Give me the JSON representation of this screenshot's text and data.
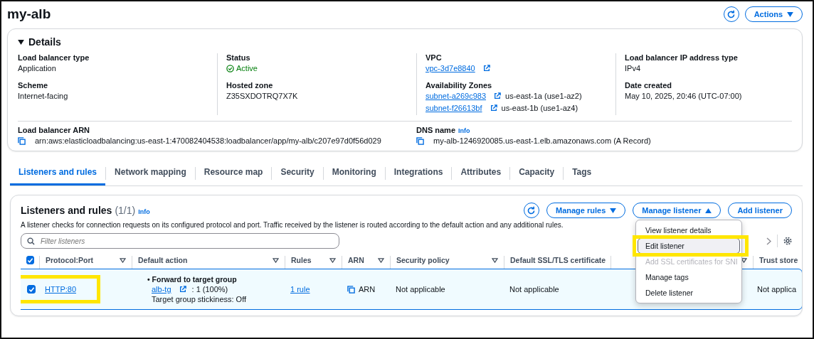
{
  "page": {
    "title": "my-alb",
    "actions_button": "Actions"
  },
  "details": {
    "title": "Details",
    "expanded": true,
    "columns": [
      [
        {
          "label": "Load balancer type",
          "kind": "text",
          "value": "Application"
        },
        {
          "label": "Scheme",
          "kind": "text",
          "value": "Internet-facing"
        }
      ],
      [
        {
          "label": "Status",
          "kind": "status",
          "value": "Active"
        },
        {
          "label": "Hosted zone",
          "kind": "text",
          "value": "Z35SXDOTRQ7X7K"
        }
      ],
      [
        {
          "label": "VPC",
          "kind": "link",
          "value": "vpc-3d7e8840"
        },
        {
          "label": "Availability Zones",
          "kind": "zones",
          "zones": [
            {
              "subnet": "subnet-a269c983",
              "zone": "us-east-1a (use1-az2)"
            },
            {
              "subnet": "subnet-f26613bf",
              "zone": "us-east-1b (use1-az4)"
            }
          ]
        }
      ],
      [
        {
          "label": "Load balancer IP address type",
          "kind": "text",
          "value": "IPv4"
        },
        {
          "label": "Date created",
          "kind": "text",
          "value": "May 10, 2025, 20:46 (UTC-07:00)"
        }
      ]
    ],
    "bottom": [
      {
        "label": "Load balancer ARN",
        "kind": "copy",
        "value": "arn:aws:elasticloadbalancing:us-east-1:470082404538:loadbalancer/app/my-alb/c207e97d0f56d029"
      },
      {
        "label": "DNS name",
        "info": "Info",
        "kind": "copy",
        "value": "my-alb-1246920085.us-east-1.elb.amazonaws.com (A Record)"
      }
    ]
  },
  "tabs": [
    {
      "label": "Listeners and rules",
      "selected": true
    },
    {
      "label": "Network mapping",
      "selected": false
    },
    {
      "label": "Resource map",
      "selected": false
    },
    {
      "label": "Security",
      "selected": false
    },
    {
      "label": "Monitoring",
      "selected": false
    },
    {
      "label": "Integrations",
      "selected": false
    },
    {
      "label": "Attributes",
      "selected": false
    },
    {
      "label": "Capacity",
      "selected": false
    },
    {
      "label": "Tags",
      "selected": false
    }
  ],
  "listeners": {
    "title": "Listeners and rules",
    "count": "(1/1)",
    "info": "Info",
    "description": "A listener checks for connection requests on its configured protocol and port. Traffic received by the listener is routed according to the default action and any additional rules.",
    "buttons": [
      {
        "label": "Manage rules",
        "kind": "dropdown",
        "expanded": false
      },
      {
        "label": "Manage listener",
        "kind": "dropdown",
        "expanded": true
      },
      {
        "label": "Add listener",
        "kind": "plain"
      }
    ],
    "menu": [
      {
        "label": "View listener details",
        "disabled": false,
        "hovered": false,
        "highlighted": false
      },
      {
        "label": "Edit listener",
        "disabled": false,
        "hovered": true,
        "highlighted": true
      },
      {
        "label": "Add SSL certificates for SNI",
        "disabled": true,
        "hovered": false,
        "highlighted": false
      },
      {
        "label": "Manage tags",
        "disabled": false,
        "hovered": false,
        "highlighted": false
      },
      {
        "label": "Delete listener",
        "disabled": false,
        "hovered": false,
        "highlighted": false
      }
    ],
    "filter": {
      "placeholder": "Filter listeners"
    },
    "all_checked": true,
    "columns": [
      {
        "label": "Protocol:Port"
      },
      {
        "label": "Default action"
      },
      {
        "label": "Rules"
      },
      {
        "label": "ARN"
      },
      {
        "label": "Security policy"
      },
      {
        "label": "Default SSL/TLS certificate"
      },
      {
        "sortable": true
      },
      {
        "label": "Trust store"
      }
    ],
    "rows": [
      {
        "selected": true,
        "highlighted": true,
        "protocol_port": "HTTP:80",
        "action_bullet": "•",
        "action_title": "Forward to target group",
        "target": "alb-tg",
        "weight": ": 1 (100%)",
        "stickiness": "Target group stickiness: Off",
        "rules": "1 rule",
        "arn": "ARN",
        "security_policy": "Not applicable",
        "ssl_certificate": "Not applicable",
        "trust_store": "Not applica"
      }
    ]
  }
}
